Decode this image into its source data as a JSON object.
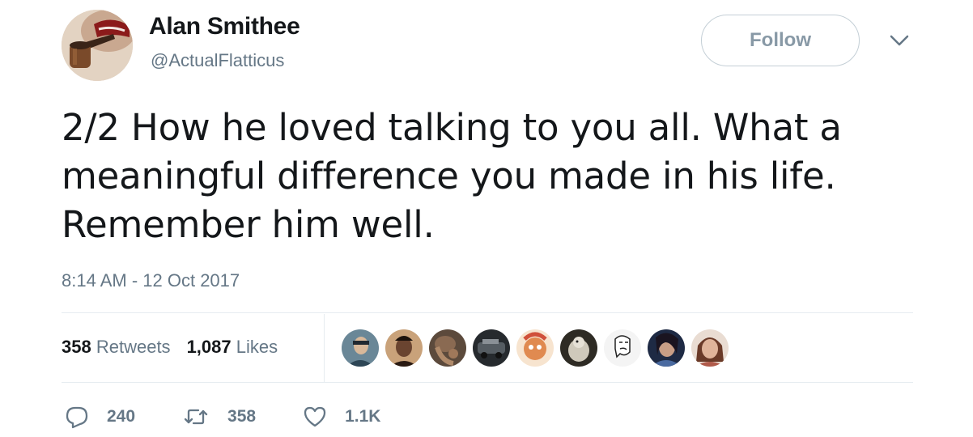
{
  "author": {
    "name": "Alan Smithee",
    "handle": "@ActualFlatticus",
    "avatar_icon": "pipe-smoker-avatar"
  },
  "follow_button": {
    "label": "Follow"
  },
  "menu": {
    "icon": "chevron-down-icon"
  },
  "tweet": {
    "text": "2/2 How he loved talking to you all. What a\nmeaningful difference you made in his life.\nRemember him well.",
    "timestamp": "8:14 AM - 12 Oct 2017"
  },
  "stats": {
    "retweets_count": "358",
    "retweets_label": "Retweets",
    "likes_count": "1,087",
    "likes_label": "Likes"
  },
  "likers": [
    {
      "name": "liker-avatar-1",
      "color": "#4a6b7d"
    },
    {
      "name": "liker-avatar-2",
      "color": "#5a3a2a"
    },
    {
      "name": "liker-avatar-3",
      "color": "#6b5a4a"
    },
    {
      "name": "liker-avatar-4",
      "color": "#2e3338"
    },
    {
      "name": "liker-avatar-5",
      "color": "#e8a070"
    },
    {
      "name": "liker-avatar-6",
      "color": "#3c3a32"
    },
    {
      "name": "liker-avatar-7",
      "color": "#f4f4f4"
    },
    {
      "name": "liker-avatar-8",
      "color": "#2a3550"
    },
    {
      "name": "liker-avatar-9",
      "color": "#8a5a4a"
    }
  ],
  "actions": {
    "reply_count": "240",
    "retweet_count": "358",
    "like_count": "1.1K"
  },
  "colors": {
    "text_primary": "#14171a",
    "text_secondary": "#657786",
    "divider": "#e6ecf0",
    "follow_border": "#c4cfd6"
  }
}
